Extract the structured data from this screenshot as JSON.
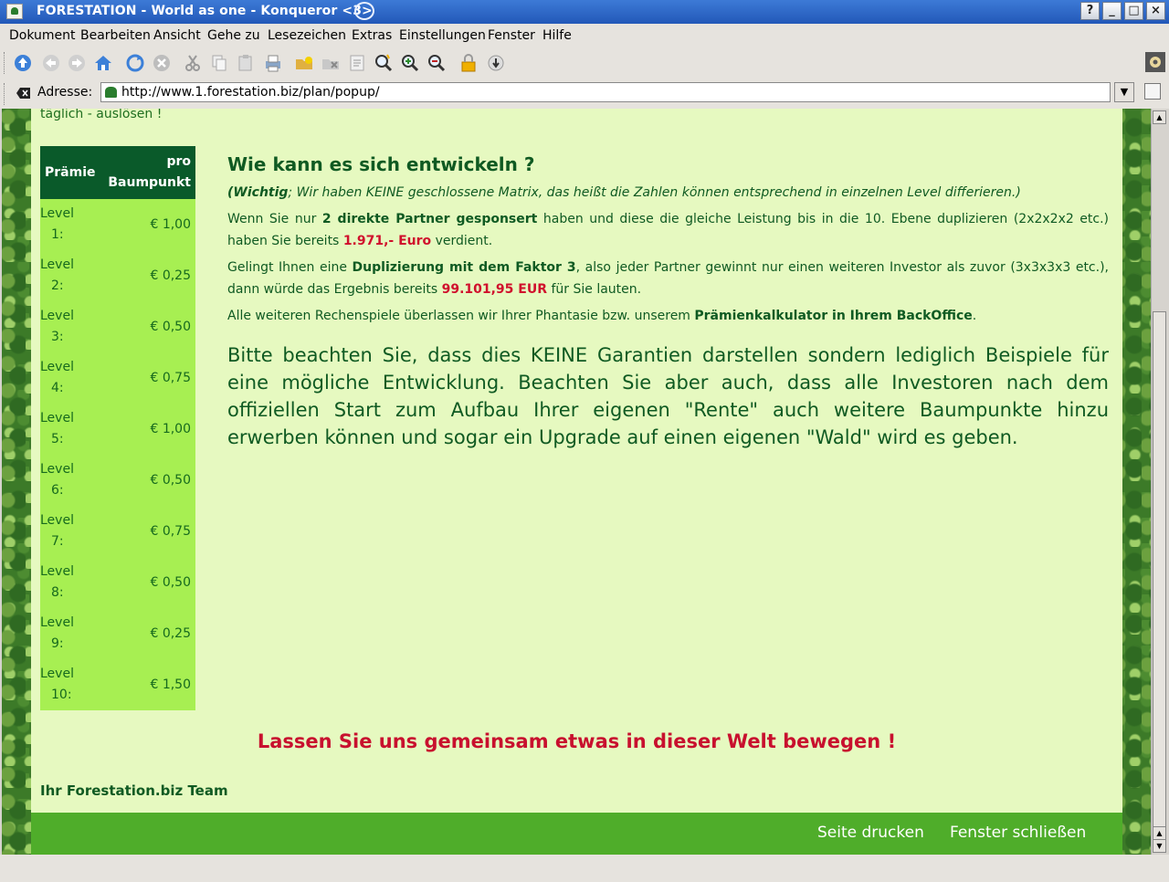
{
  "window": {
    "title": "FORESTATION - World as one - Konqueror <3>"
  },
  "menu": {
    "items": [
      "Dokument",
      "Bearbeiten",
      "Ansicht",
      "Gehe zu",
      "Lesezeichen",
      "Extras",
      "Einstellungen",
      "Fenster",
      "Hilfe"
    ]
  },
  "address": {
    "label": "Adresse:",
    "url": "http://www.1.forestation.biz/plan/popup/"
  },
  "page": {
    "cut_text": "täglich - auslösen !",
    "table": {
      "header_left": "Prämie",
      "header_right_1": "pro",
      "header_right_2": "Baumpunkt",
      "rows": [
        {
          "level": "Level",
          "num": "1:",
          "value": "€ 1,00"
        },
        {
          "level": "Level",
          "num": "2:",
          "value": "€ 0,25"
        },
        {
          "level": "Level",
          "num": "3:",
          "value": "€ 0,50"
        },
        {
          "level": "Level",
          "num": "4:",
          "value": "€ 0,75"
        },
        {
          "level": "Level",
          "num": "5:",
          "value": "€ 1,00"
        },
        {
          "level": "Level",
          "num": "6:",
          "value": "€ 0,50"
        },
        {
          "level": "Level",
          "num": "7:",
          "value": "€ 0,75"
        },
        {
          "level": "Level",
          "num": "8:",
          "value": "€ 0,50"
        },
        {
          "level": "Level",
          "num": "9:",
          "value": "€ 0,25"
        },
        {
          "level": "Level",
          "num": "10:",
          "value": "€ 1,50"
        }
      ]
    },
    "heading": "Wie kann es sich entwickeln ?",
    "note_bold": "(Wichtig",
    "note_rest": "; Wir haben KEINE geschlossene Matrix, das heißt die Zahlen können entsprechend in einzelnen Level differieren.)",
    "p1_a": "Wenn Sie nur ",
    "p1_b": "2 direkte Partner gesponsert",
    "p1_c": " haben und diese die gleiche Leistung bis in die 10. Ebene duplizieren (2x2x2x2 etc.) haben Sie bereits ",
    "p1_d": "1.971,- Euro",
    "p1_e": " verdient.",
    "p2_a": "Gelingt Ihnen eine ",
    "p2_b": "Duplizierung mit dem Faktor 3",
    "p2_c": ", also jeder Partner gewinnt nur einen weiteren Investor als zuvor (3x3x3x3 etc.), dann würde das Ergebnis bereits ",
    "p2_d": "99.101,95 EUR",
    "p2_e": " für Sie lauten.",
    "p3_a": "Alle weiteren Rechenspiele überlassen wir Ihrer Phantasie bzw. unserem ",
    "p3_b": "Prämienkalkulator in Ihrem BackOffice",
    "p3_c": ".",
    "big": "Bitte beachten Sie, dass dies KEINE Garantien darstellen sondern lediglich Beispiele für eine mögliche Entwicklung. Beachten Sie aber auch, dass alle Investoren nach dem offiziellen Start zum Aufbau Ihrer eigenen \"Rente\" auch weitere Baumpunkte hinzu erwerben können und sogar ein Upgrade auf einen eigenen \"Wald\" wird es geben.",
    "slogan": "Lassen Sie uns gemeinsam etwas in dieser Welt bewegen !",
    "team": "Ihr Forestation.biz Team",
    "footer": {
      "print": "Seite drucken",
      "close": "Fenster schließen"
    }
  }
}
